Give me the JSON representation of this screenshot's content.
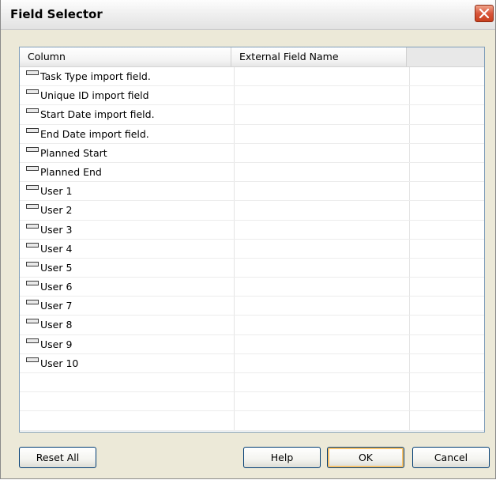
{
  "window": {
    "title": "Field Selector"
  },
  "grid": {
    "columns": [
      "Column",
      "External Field Name",
      ""
    ],
    "rows": [
      {
        "column": "Task Type import field.",
        "external": ""
      },
      {
        "column": "Unique ID import field",
        "external": ""
      },
      {
        "column": "Start Date import field.",
        "external": ""
      },
      {
        "column": "End Date import field.",
        "external": ""
      },
      {
        "column": "Planned Start",
        "external": ""
      },
      {
        "column": "Planned End",
        "external": ""
      },
      {
        "column": "User 1",
        "external": ""
      },
      {
        "column": "User 2",
        "external": ""
      },
      {
        "column": "User 3",
        "external": ""
      },
      {
        "column": "User 4",
        "external": ""
      },
      {
        "column": "User 5",
        "external": ""
      },
      {
        "column": "User 6",
        "external": ""
      },
      {
        "column": "User 7",
        "external": ""
      },
      {
        "column": "User 8",
        "external": ""
      },
      {
        "column": "User 9",
        "external": ""
      },
      {
        "column": "User 10",
        "external": ""
      },
      {
        "column": "",
        "external": ""
      },
      {
        "column": "",
        "external": ""
      },
      {
        "column": "",
        "external": ""
      }
    ],
    "row_icon": "field-icon"
  },
  "buttons": {
    "reset_all": "Reset All",
    "help": "Help",
    "ok": "OK",
    "cancel": "Cancel"
  },
  "colors": {
    "dialog_bg": "#ece9d8",
    "close_button": "#d8553a",
    "default_button_highlight": "#f7c26b",
    "grid_border": "#7f9db9"
  }
}
